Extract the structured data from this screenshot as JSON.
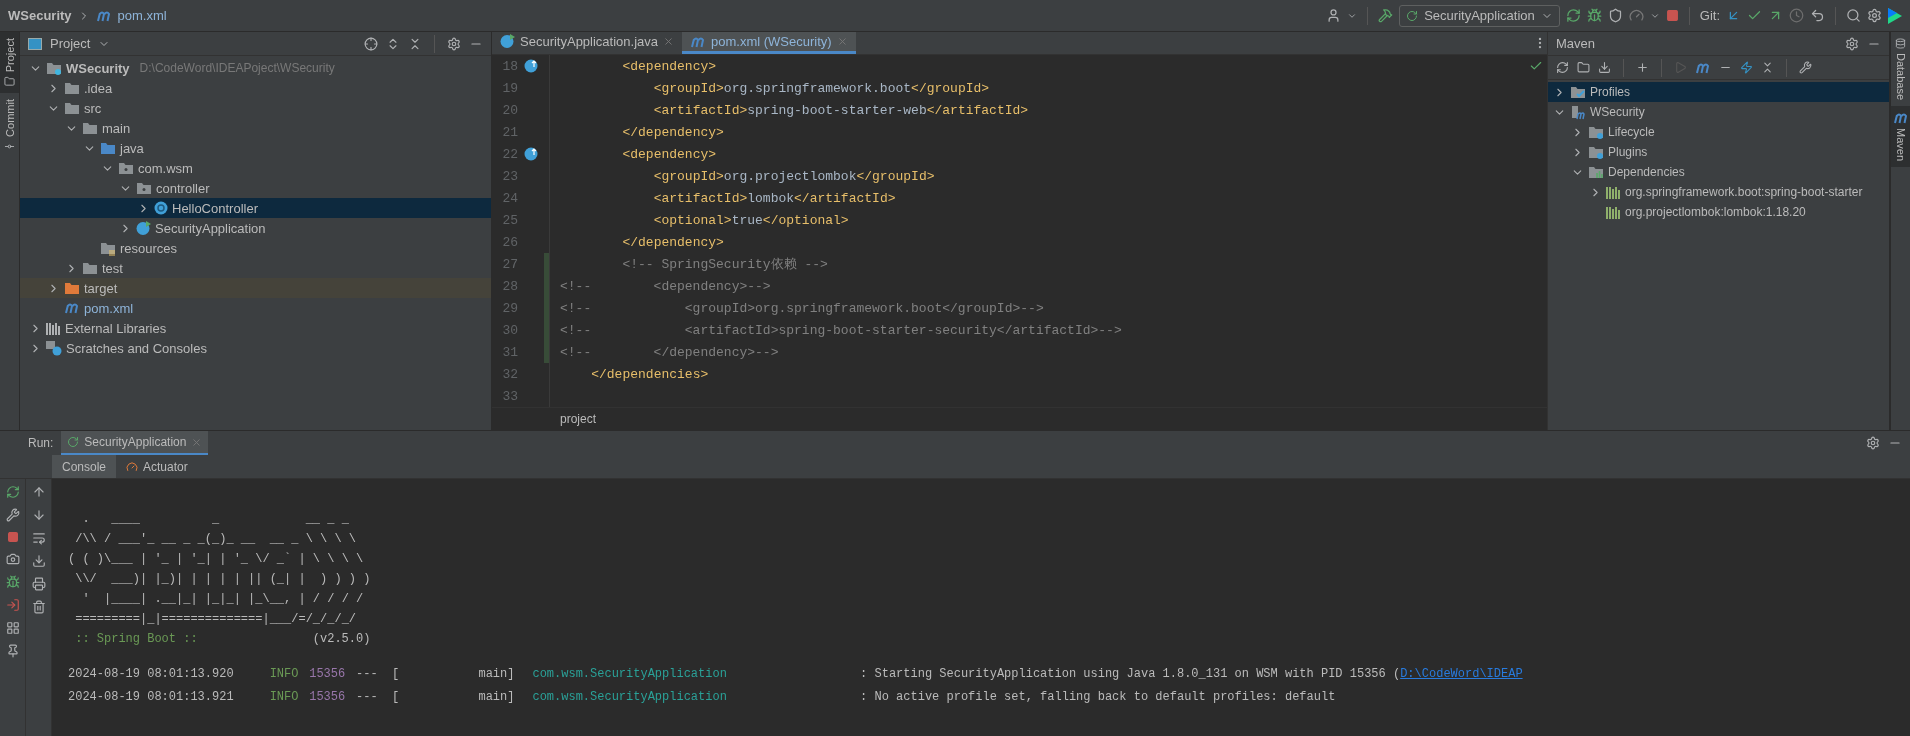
{
  "title_bar": {
    "breadcrumb": [
      {
        "label": "WSecurity",
        "kind": "project"
      },
      {
        "label": "pom.xml",
        "kind": "maven"
      }
    ],
    "run_config": "SecurityApplication",
    "git_label": "Git:"
  },
  "left_strip": [
    {
      "label": "Project",
      "selected": true,
      "kind": "project"
    },
    {
      "label": "Commit",
      "selected": false,
      "kind": "commit"
    }
  ],
  "project_panel": {
    "title": "Project",
    "tree": [
      {
        "label": "WSecurity",
        "hint": "D:\\CodeWord\\IDEAPoject\\WSecurity",
        "kind": "module",
        "expanded": true,
        "selected": false,
        "children": [
          {
            "label": ".idea",
            "kind": "folder",
            "expanded": false,
            "selected": false
          },
          {
            "label": "src",
            "kind": "folder",
            "expanded": true,
            "selected": false,
            "children": [
              {
                "label": "main",
                "kind": "folder",
                "expanded": true,
                "selected": false,
                "children": [
                  {
                    "label": "java",
                    "kind": "source",
                    "expanded": true,
                    "selected": false,
                    "children": [
                      {
                        "label": "com.wsm",
                        "kind": "package",
                        "expanded": true,
                        "selected": false,
                        "children": [
                          {
                            "label": "controller",
                            "kind": "package",
                            "expanded": true,
                            "selected": false,
                            "children": [
                              {
                                "label": "HelloController",
                                "kind": "class",
                                "expanded": false,
                                "selected": true
                              }
                            ]
                          },
                          {
                            "label": "SecurityApplication",
                            "kind": "app",
                            "expanded": false,
                            "selected": false
                          }
                        ]
                      }
                    ]
                  },
                  {
                    "label": "resources",
                    "kind": "resources",
                    "selected": false
                  }
                ]
              },
              {
                "label": "test",
                "kind": "folder",
                "expanded": false,
                "selected": false
              }
            ]
          },
          {
            "label": "target",
            "kind": "excluded",
            "expanded": false,
            "selected": false
          },
          {
            "label": "pom.xml",
            "kind": "maven",
            "selected": false
          }
        ]
      },
      {
        "label": "External Libraries",
        "kind": "libraries",
        "expanded": false,
        "selected": false
      },
      {
        "label": "Scratches and Consoles",
        "kind": "scratches",
        "expanded": false,
        "selected": false
      }
    ]
  },
  "editor": {
    "tabs": [
      {
        "label": "SecurityApplication.java",
        "kind": "app",
        "selected": false
      },
      {
        "label": "pom.xml (WSecurity)",
        "kind": "maven",
        "selected": true
      }
    ],
    "lines": [
      {
        "number": "18",
        "kind": "xml",
        "code": "        <dependency>",
        "marker": true,
        "changed": false
      },
      {
        "number": "19",
        "kind": "xml",
        "code": "            <groupId>org.springframework.boot</groupId>",
        "marker": false,
        "changed": false
      },
      {
        "number": "20",
        "kind": "xml",
        "code": "            <artifactId>spring-boot-starter-web</artifactId>",
        "marker": false,
        "changed": false
      },
      {
        "number": "21",
        "kind": "xml",
        "code": "        </dependency>",
        "marker": false,
        "changed": false
      },
      {
        "number": "22",
        "kind": "xml",
        "code": "        <dependency>",
        "marker": true,
        "changed": false
      },
      {
        "number": "23",
        "kind": "xml",
        "code": "            <groupId>org.projectlombok</groupId>",
        "marker": false,
        "changed": false
      },
      {
        "number": "24",
        "kind": "xml",
        "code": "            <artifactId>lombok</artifactId>",
        "marker": false,
        "changed": false
      },
      {
        "number": "25",
        "kind": "xml",
        "code": "            <optional>true</optional>",
        "marker": false,
        "changed": false
      },
      {
        "number": "26",
        "kind": "xml",
        "code": "        </dependency>",
        "marker": false,
        "changed": false
      },
      {
        "number": "27",
        "kind": "comment",
        "code": "        <!-- SpringSecurity依赖 -->",
        "marker": false,
        "changed": true
      },
      {
        "number": "28",
        "kind": "comment",
        "code": "<!--        <dependency>-->",
        "marker": false,
        "changed": true
      },
      {
        "number": "29",
        "kind": "comment",
        "code": "<!--            <groupId>org.springframework.boot</groupId>-->",
        "marker": false,
        "changed": true
      },
      {
        "number": "30",
        "kind": "comment",
        "code": "<!--            <artifactId>spring-boot-starter-security</artifactId>-->",
        "marker": false,
        "changed": true
      },
      {
        "number": "31",
        "kind": "comment",
        "code": "<!--        </dependency>-->",
        "marker": false,
        "changed": true
      },
      {
        "number": "32",
        "kind": "xml",
        "code": "    </dependencies>",
        "marker": false,
        "changed": false
      },
      {
        "number": "33",
        "marker": false,
        "changed": false
      }
    ],
    "breadcrumb": "project"
  },
  "maven_panel": {
    "title": "Maven",
    "tree": [
      {
        "label": "Profiles",
        "kind": "profiles",
        "expanded": false,
        "selected": true
      },
      {
        "label": "WSecurity",
        "kind": "maven-module",
        "expanded": true,
        "selected": false,
        "children": [
          {
            "label": "Lifecycle",
            "kind": "lifecycle",
            "expanded": false,
            "selected": false
          },
          {
            "label": "Plugins",
            "kind": "lifecycle",
            "expanded": false,
            "selected": false
          },
          {
            "label": "Dependencies",
            "kind": "dependencies",
            "expanded": true,
            "selected": false,
            "children": [
              {
                "label": "org.springframework.boot:spring-boot-starter",
                "kind": "library",
                "expanded": false,
                "selected": false
              },
              {
                "label": "org.projectlombok:lombok:1.18.20",
                "kind": "library",
                "selected": false
              }
            ]
          }
        ]
      }
    ]
  },
  "right_strip": [
    {
      "label": "Database",
      "selected": false,
      "kind": "database"
    },
    {
      "label": "Maven",
      "selected": true,
      "kind": "maven"
    }
  ],
  "run_panel": {
    "label": "Run:",
    "tab": "SecurityApplication",
    "subtabs": [
      {
        "label": "Console",
        "kind": "console",
        "selected": true
      },
      {
        "label": "Actuator",
        "kind": "actuator",
        "selected": false
      }
    ],
    "banner": [
      "  .   ____          _            __ _ _",
      " /\\\\ / ___'_ __ _ _(_)_ __  __ _ \\ \\ \\ \\",
      "( ( )\\___ | '_ | '_| | '_ \\/ _` | \\ \\ \\ \\",
      " \\\\/  ___)| |_)| | | | | || (_| |  ) ) ) )",
      "  '  |____| .__|_| |_|_| |_\\__, | / / / /",
      " =========|_|==============|___/=/_/_/_/"
    ],
    "banner_footer": {
      "label": ":: Spring Boot ::",
      "version": "(v2.5.0)"
    },
    "logs": [
      {
        "time": "2024-08-19 08:01:13.920",
        "level": "INFO",
        "pid": "15356",
        "separator": "---",
        "thread": "[           main]",
        "logger": "com.wsm.SecurityApplication",
        "message": ": Starting SecurityApplication using Java 1.8.0_131 on WSM with PID 15356 (",
        "link": "D:\\CodeWord\\IDEAP"
      },
      {
        "time": "2024-08-19 08:01:13.921",
        "level": "INFO",
        "pid": "15356",
        "separator": "---",
        "thread": "[           main]",
        "logger": "com.wsm.SecurityApplication",
        "message": ": No active profile set, falling back to default profiles: default"
      }
    ]
  }
}
